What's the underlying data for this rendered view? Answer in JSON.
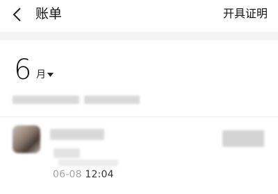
{
  "header": {
    "title": "账单",
    "action_label": "开具证明"
  },
  "month_picker": {
    "month": "6",
    "unit": "月"
  },
  "transactions": [
    {
      "time": "06-08 12:04"
    }
  ],
  "icons": {
    "back": "chevron-left-icon",
    "month_caret": "caret-down-icon"
  },
  "colors": {
    "background": "#ffffff",
    "band": "#f4f4f4",
    "text": "#111111"
  }
}
